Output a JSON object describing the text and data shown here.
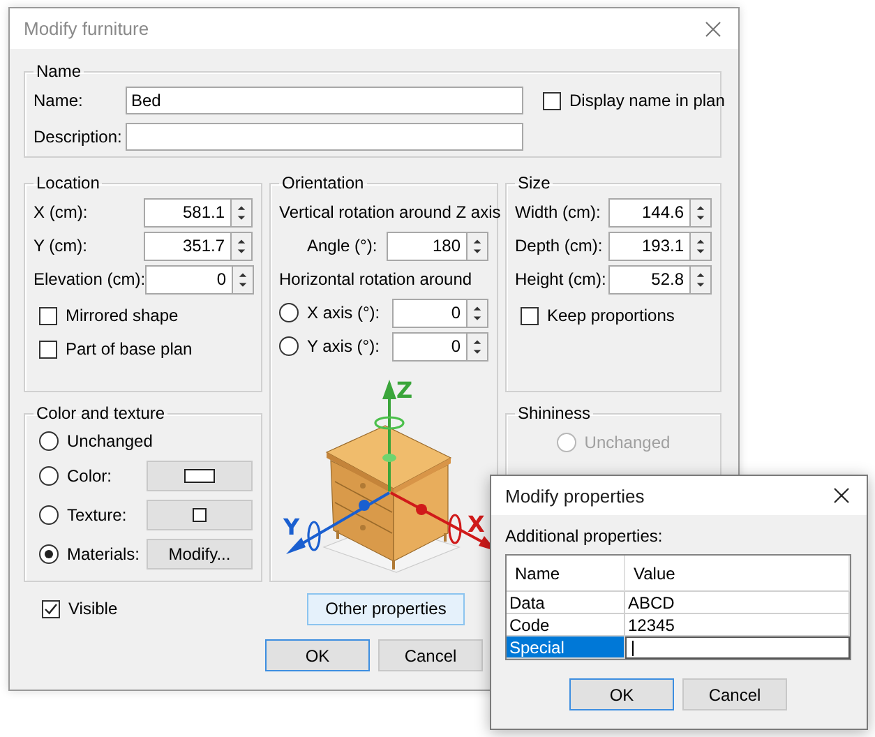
{
  "window": {
    "title": "Modify furniture"
  },
  "name_group": {
    "title": "Name",
    "name_label": "Name:",
    "name_value": "Bed",
    "description_label": "Description:",
    "display_in_plan": {
      "label": "Display name in plan",
      "checked": false
    }
  },
  "location": {
    "title": "Location",
    "fields": [
      {
        "label": "X (cm):",
        "value": "581.1"
      },
      {
        "label": "Y (cm):",
        "value": "351.7"
      },
      {
        "label": "Elevation (cm):",
        "value": "0"
      }
    ],
    "checkboxes": [
      {
        "label": "Mirrored shape",
        "checked": false
      },
      {
        "label": "Part of base plan",
        "checked": false
      }
    ]
  },
  "orientation": {
    "title": "Orientation",
    "vertical_heading": "Vertical rotation around Z axis",
    "angle": {
      "label": "Angle (°):",
      "value": "180"
    },
    "horizontal_heading": "Horizontal rotation around",
    "axes": [
      {
        "label": "X axis (°):",
        "value": "0",
        "selected": false
      },
      {
        "label": "Y axis (°):",
        "value": "0",
        "selected": false
      }
    ],
    "axis_labels": {
      "x": "X",
      "y": "Y",
      "z": "Z"
    }
  },
  "size": {
    "title": "Size",
    "fields": [
      {
        "label": "Width (cm):",
        "value": "144.6"
      },
      {
        "label": "Depth (cm):",
        "value": "193.1"
      },
      {
        "label": "Height (cm):",
        "value": "52.8"
      }
    ],
    "keep_proportions": {
      "label": "Keep proportions",
      "checked": false
    }
  },
  "color_and_texture": {
    "title": "Color and texture",
    "options": [
      {
        "kind": "plain",
        "label": "Unchanged",
        "selected": false
      },
      {
        "kind": "color",
        "label": "Color:",
        "selected": false
      },
      {
        "kind": "texture",
        "label": "Texture:",
        "selected": false
      },
      {
        "kind": "action",
        "label": "Materials:",
        "selected": true,
        "button_label": "Modify..."
      }
    ]
  },
  "shininess": {
    "title": "Shininess",
    "options": [
      {
        "label": "Unchanged",
        "selected": false,
        "disabled": true
      }
    ]
  },
  "visible": {
    "label": "Visible",
    "checked": true
  },
  "other_properties": {
    "label": "Other properties",
    "kind": "hover"
  },
  "buttons": [
    {
      "label": "OK",
      "kind": "default"
    },
    {
      "label": "Cancel",
      "kind": "normal"
    }
  ],
  "properties_dialog": {
    "title": "Modify properties",
    "heading": "Additional properties:",
    "columns": [
      "Name",
      "Value"
    ],
    "rows": [
      {
        "name": "Data",
        "value": "ABCD",
        "selected": false,
        "editing": false
      },
      {
        "name": "Code",
        "value": "12345",
        "selected": false,
        "editing": false
      },
      {
        "name": "Special",
        "selected": true,
        "editing": true
      }
    ],
    "buttons": [
      {
        "label": "OK",
        "kind": "default"
      },
      {
        "label": "Cancel",
        "kind": "normal"
      }
    ]
  }
}
